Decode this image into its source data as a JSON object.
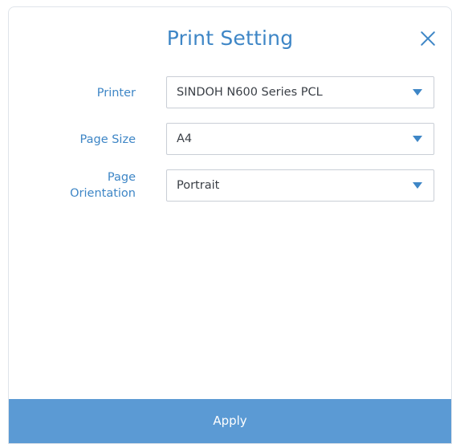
{
  "dialog": {
    "title": "Print Setting",
    "close_icon": "close-icon",
    "accent_color": "#3e86c6",
    "apply_color": "#5b9ad4"
  },
  "fields": {
    "printer": {
      "label": "Printer",
      "value": "SINDOH N600 Series PCL"
    },
    "page_size": {
      "label": "Page Size",
      "value": "A4"
    },
    "page_orientation": {
      "label_line1": "Page",
      "label_line2": "Orientation",
      "value": "Portrait"
    }
  },
  "footer": {
    "apply_label": "Apply"
  }
}
